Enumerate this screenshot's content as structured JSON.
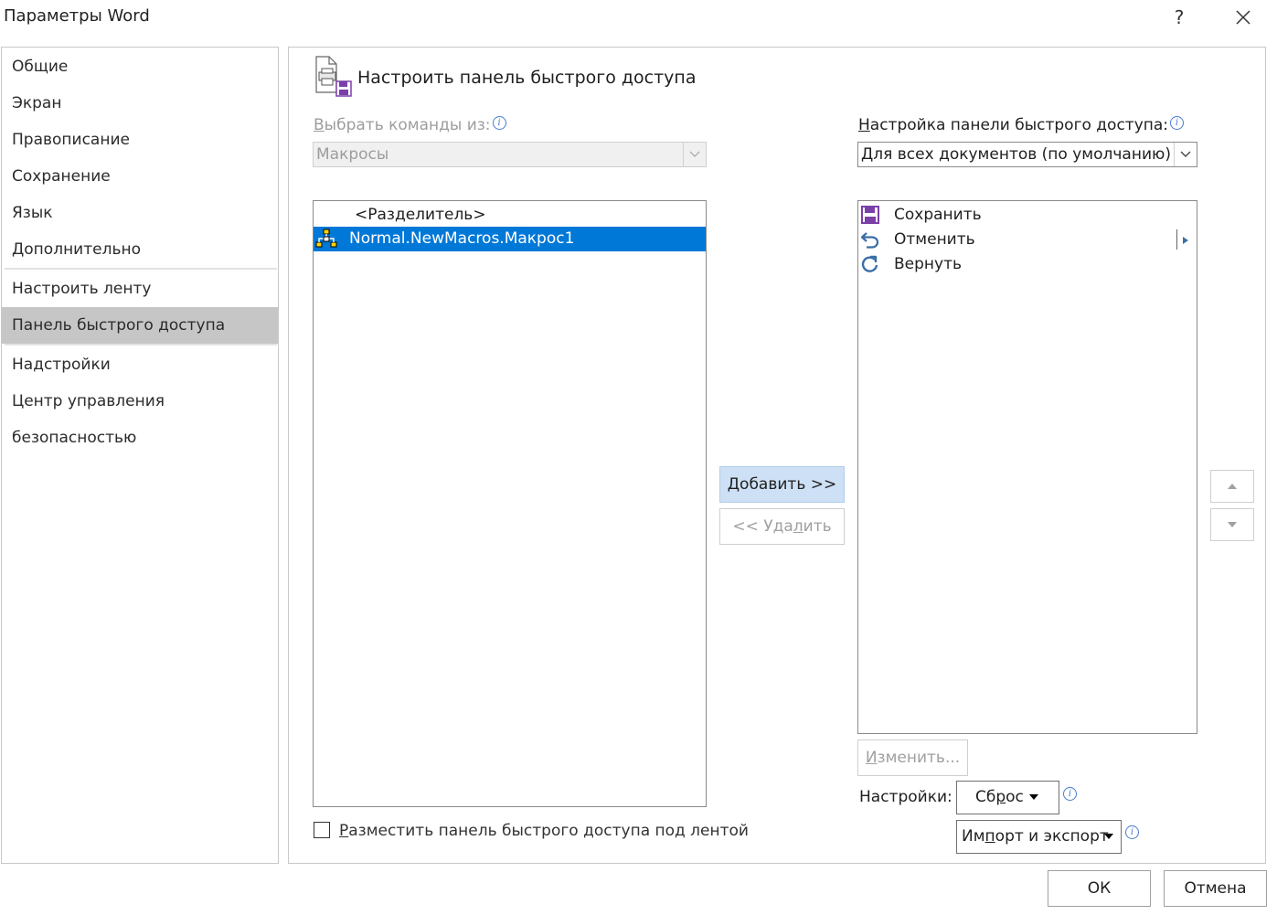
{
  "window": {
    "title": "Параметры Word",
    "help_label": "?",
    "close_label": "✕"
  },
  "nav": {
    "items": [
      {
        "label": "Общие"
      },
      {
        "label": "Экран"
      },
      {
        "label": "Правописание"
      },
      {
        "label": "Сохранение"
      },
      {
        "label": "Язык"
      },
      {
        "label": "Дополнительно"
      },
      {
        "label": "Настроить ленту"
      },
      {
        "label": "Панель быстрого доступа",
        "active": true
      },
      {
        "label": "Надстройки"
      },
      {
        "label": "Центр управления безопасностью"
      }
    ]
  },
  "main": {
    "heading": "Настроить панель быстрого доступа",
    "choose_from": {
      "label_first": "В",
      "label_rest": "ыбрать команды из:",
      "value": "Макросы"
    },
    "customize_for": {
      "label_first": "Н",
      "label_rest": "астройка панели быстрого доступа:",
      "value": "Для всех документов (по умолчанию)"
    },
    "available_commands": [
      {
        "label": "<Разделитель>",
        "icon": "none"
      },
      {
        "label": "Normal.NewMacros.Макрос1",
        "icon": "macro-icon",
        "selected": true
      }
    ],
    "qat_commands": [
      {
        "label": "Сохранить",
        "icon": "save-icon"
      },
      {
        "label": "Отменить",
        "icon": "undo-icon"
      },
      {
        "label": "Вернуть",
        "icon": "redo-icon"
      }
    ],
    "add_button": {
      "first": "Д",
      "rest": "обавить >>"
    },
    "remove_button": {
      "pre": "<< Уда",
      "under": "л",
      "post": "ить"
    },
    "modify_button": {
      "first": "И",
      "rest": "зменить..."
    },
    "settings_label": "Настройки:",
    "reset_button": {
      "pre": "Сб",
      "under": "р",
      "post": "ос"
    },
    "import_export_button": {
      "pre": "Им",
      "under": "п",
      "post": "орт и экспорт"
    },
    "show_below_ribbon": {
      "first": "Р",
      "rest": "азместить панель быстрого доступа под лентой",
      "checked": false
    }
  },
  "footer": {
    "ok_label": "ОК",
    "cancel_label": "Отмена"
  },
  "colors": {
    "selection": "#0078d7",
    "nav_active": "#c6c6c6",
    "add_button_bg": "#cde0f5",
    "save_icon": "#7b3fa8",
    "undo_redo_icon": "#3a6ea8"
  }
}
